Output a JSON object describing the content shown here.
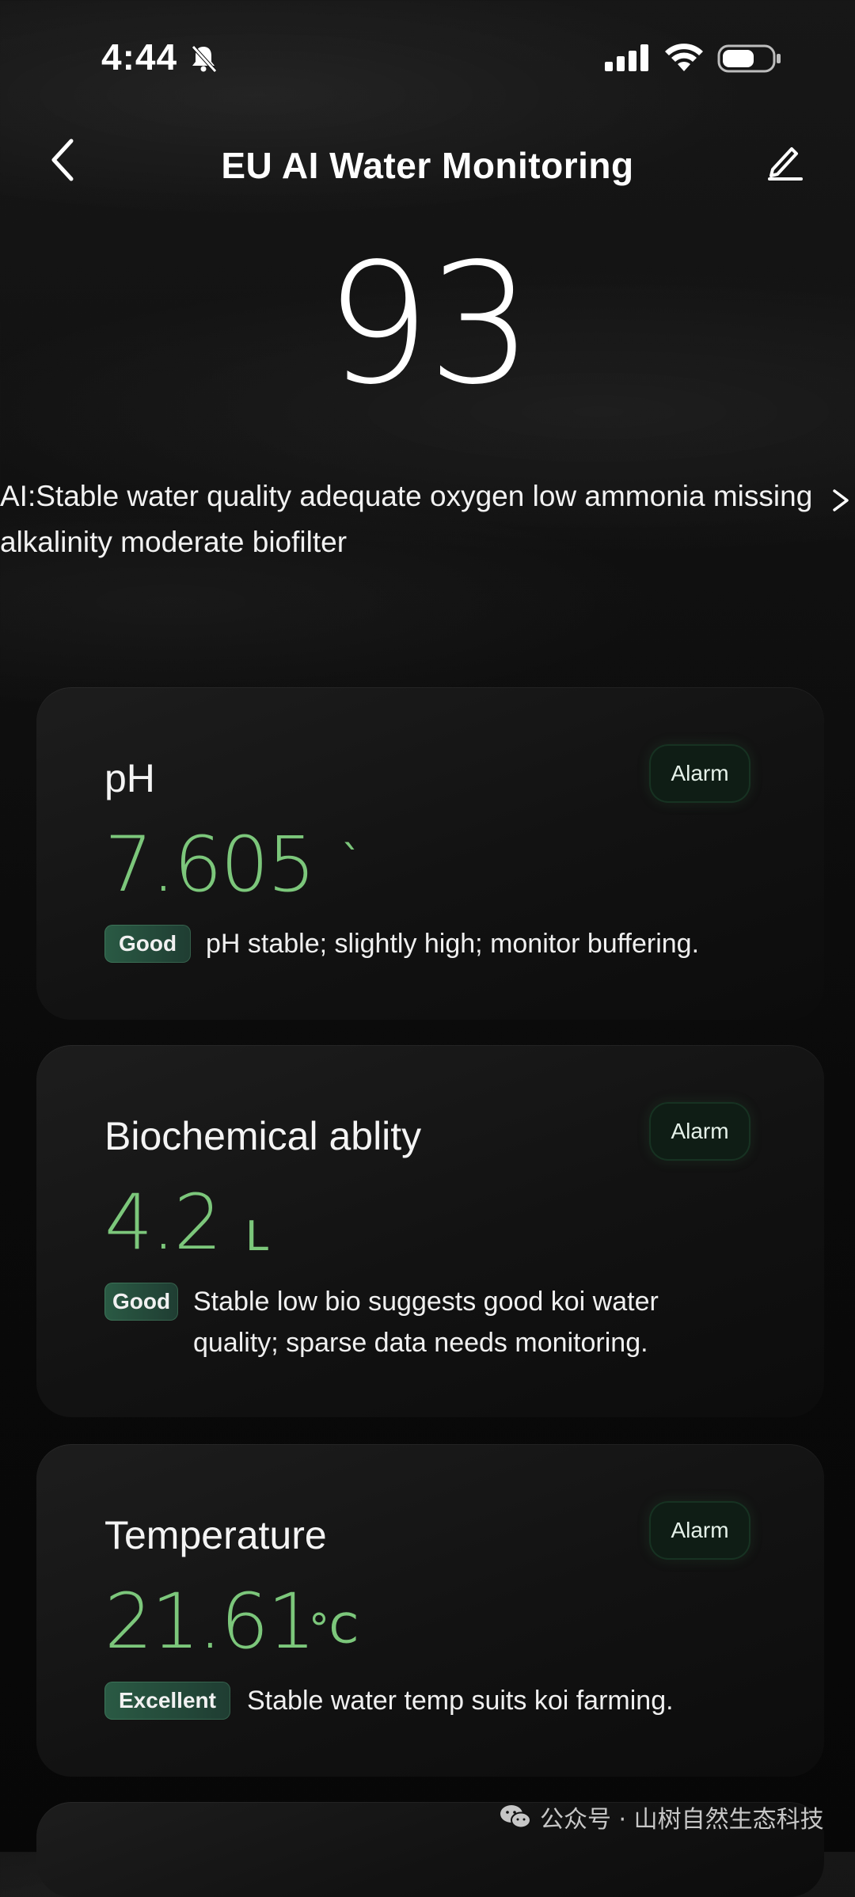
{
  "status_bar": {
    "time": "4:44",
    "icons": [
      "bell-off-icon",
      "signal-icon",
      "wifi-icon",
      "battery-icon"
    ],
    "battery_level": 0.65
  },
  "header": {
    "title": "EU AI Water Monitoring",
    "icons": [
      "back-icon",
      "edit-icon"
    ]
  },
  "score": "93",
  "ai_summary": {
    "text": "AI:Stable water quality adequate oxygen low ammonia missing alkalinity moderate biofilter",
    "more_icon": "chevron-right-icon"
  },
  "cards": [
    {
      "title": "pH",
      "alarm_label": "Alarm",
      "value": "7.605",
      "unit": "`",
      "status": "Good",
      "description": "pH stable; slightly high; monitor buffering."
    },
    {
      "title": "Biochemical ablity",
      "alarm_label": "Alarm",
      "value": "4.2",
      "unit": "L",
      "status": "Good",
      "description": "Stable low bio suggests good koi water quality; sparse data needs monitoring."
    },
    {
      "title": "Temperature",
      "alarm_label": "Alarm",
      "value": "21.61",
      "unit": "°C",
      "status": "Excellent",
      "description": "Stable water temp suits koi farming."
    }
  ],
  "watermark": {
    "icon": "wechat-icon",
    "text": "公众号 · 山树自然生态科技"
  },
  "colors": {
    "accent_green": "#7cc77b",
    "badge_green": "#2a5a44",
    "background": "#0b0b0b"
  }
}
